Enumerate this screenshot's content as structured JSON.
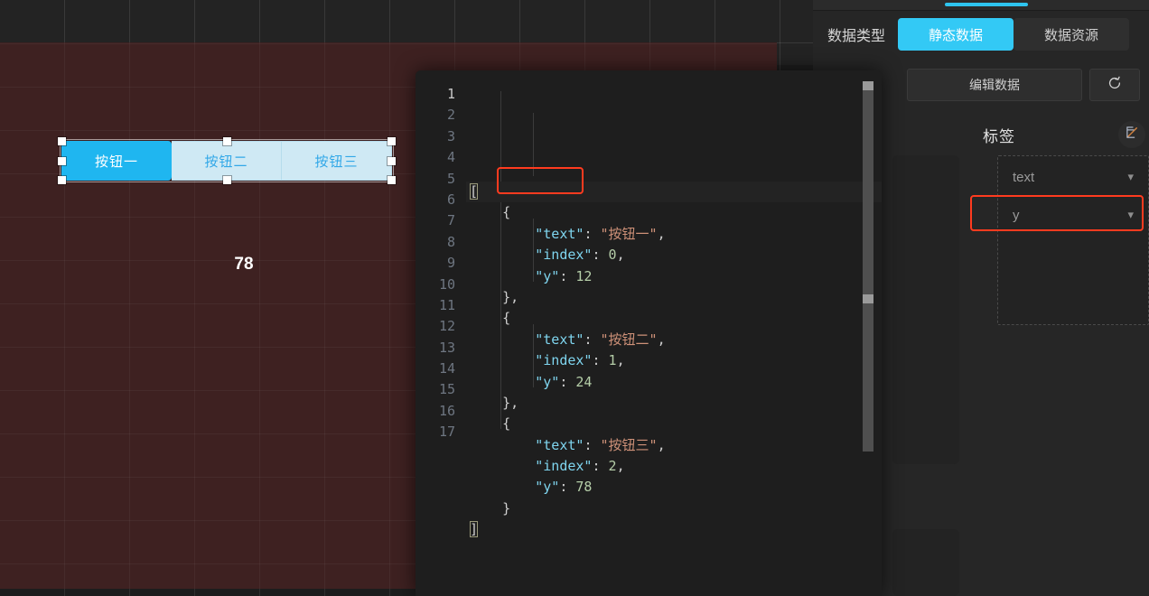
{
  "canvas": {
    "button_group": {
      "buttons": [
        {
          "label": "按钮一",
          "active": true
        },
        {
          "label": "按钮二",
          "active": false
        },
        {
          "label": "按钮三",
          "active": false
        }
      ]
    },
    "value_label": "78"
  },
  "right_panel": {
    "data_type_label": "数据类型",
    "tabs": [
      {
        "label": "静态数据",
        "active": true
      },
      {
        "label": "数据资源",
        "active": false
      }
    ],
    "edit_data_label": "编辑数据",
    "refresh_icon": "refresh-icon",
    "label_section": {
      "title": "标签",
      "edit_icon": "edit-pencil-icon",
      "fields": [
        {
          "value": "text",
          "highlighted": false
        },
        {
          "value": "y",
          "highlighted": true
        }
      ]
    }
  },
  "code_editor": {
    "line_numbers": [
      "1",
      "2",
      "3",
      "4",
      "5",
      "6",
      "7",
      "8",
      "9",
      "10",
      "11",
      "12",
      "13",
      "14",
      "15",
      "16",
      "17"
    ],
    "highlight_note": "\"y\": 12",
    "lines": [
      {
        "n": "1",
        "tokens": [
          {
            "t": "[",
            "c": "p"
          }
        ]
      },
      {
        "n": "2",
        "tokens": [
          {
            "t": "    {",
            "c": "p"
          }
        ]
      },
      {
        "n": "3",
        "tokens": [
          {
            "t": "        ",
            "c": "p"
          },
          {
            "t": "\"text\"",
            "c": "k"
          },
          {
            "t": ": ",
            "c": "p"
          },
          {
            "t": "\"按钮一\"",
            "c": "s"
          },
          {
            "t": ",",
            "c": "p"
          }
        ]
      },
      {
        "n": "4",
        "tokens": [
          {
            "t": "        ",
            "c": "p"
          },
          {
            "t": "\"index\"",
            "c": "k"
          },
          {
            "t": ": ",
            "c": "p"
          },
          {
            "t": "0",
            "c": "n"
          },
          {
            "t": ",",
            "c": "p"
          }
        ]
      },
      {
        "n": "5",
        "tokens": [
          {
            "t": "        ",
            "c": "p"
          },
          {
            "t": "\"y\"",
            "c": "k"
          },
          {
            "t": ": ",
            "c": "p"
          },
          {
            "t": "12",
            "c": "n"
          }
        ]
      },
      {
        "n": "6",
        "tokens": [
          {
            "t": "    },",
            "c": "p"
          }
        ]
      },
      {
        "n": "7",
        "tokens": [
          {
            "t": "    {",
            "c": "p"
          }
        ]
      },
      {
        "n": "8",
        "tokens": [
          {
            "t": "        ",
            "c": "p"
          },
          {
            "t": "\"text\"",
            "c": "k"
          },
          {
            "t": ": ",
            "c": "p"
          },
          {
            "t": "\"按钮二\"",
            "c": "s"
          },
          {
            "t": ",",
            "c": "p"
          }
        ]
      },
      {
        "n": "9",
        "tokens": [
          {
            "t": "        ",
            "c": "p"
          },
          {
            "t": "\"index\"",
            "c": "k"
          },
          {
            "t": ": ",
            "c": "p"
          },
          {
            "t": "1",
            "c": "n"
          },
          {
            "t": ",",
            "c": "p"
          }
        ]
      },
      {
        "n": "10",
        "tokens": [
          {
            "t": "        ",
            "c": "p"
          },
          {
            "t": "\"y\"",
            "c": "k"
          },
          {
            "t": ": ",
            "c": "p"
          },
          {
            "t": "24",
            "c": "n"
          }
        ]
      },
      {
        "n": "11",
        "tokens": [
          {
            "t": "    },",
            "c": "p"
          }
        ]
      },
      {
        "n": "12",
        "tokens": [
          {
            "t": "    {",
            "c": "p"
          }
        ]
      },
      {
        "n": "13",
        "tokens": [
          {
            "t": "        ",
            "c": "p"
          },
          {
            "t": "\"text\"",
            "c": "k"
          },
          {
            "t": ": ",
            "c": "p"
          },
          {
            "t": "\"按钮三\"",
            "c": "s"
          },
          {
            "t": ",",
            "c": "p"
          }
        ]
      },
      {
        "n": "14",
        "tokens": [
          {
            "t": "        ",
            "c": "p"
          },
          {
            "t": "\"index\"",
            "c": "k"
          },
          {
            "t": ": ",
            "c": "p"
          },
          {
            "t": "2",
            "c": "n"
          },
          {
            "t": ",",
            "c": "p"
          }
        ]
      },
      {
        "n": "15",
        "tokens": [
          {
            "t": "        ",
            "c": "p"
          },
          {
            "t": "\"y\"",
            "c": "k"
          },
          {
            "t": ": ",
            "c": "p"
          },
          {
            "t": "78",
            "c": "n"
          }
        ]
      },
      {
        "n": "16",
        "tokens": [
          {
            "t": "    }",
            "c": "p"
          }
        ]
      },
      {
        "n": "17",
        "tokens": [
          {
            "t": "]",
            "c": "p"
          }
        ]
      }
    ]
  },
  "colors": {
    "accent_cyan": "#33c9f5",
    "highlight_red": "#ff3b1f",
    "component_bg": "#3e2121",
    "button_light": "#cfe9f4"
  }
}
